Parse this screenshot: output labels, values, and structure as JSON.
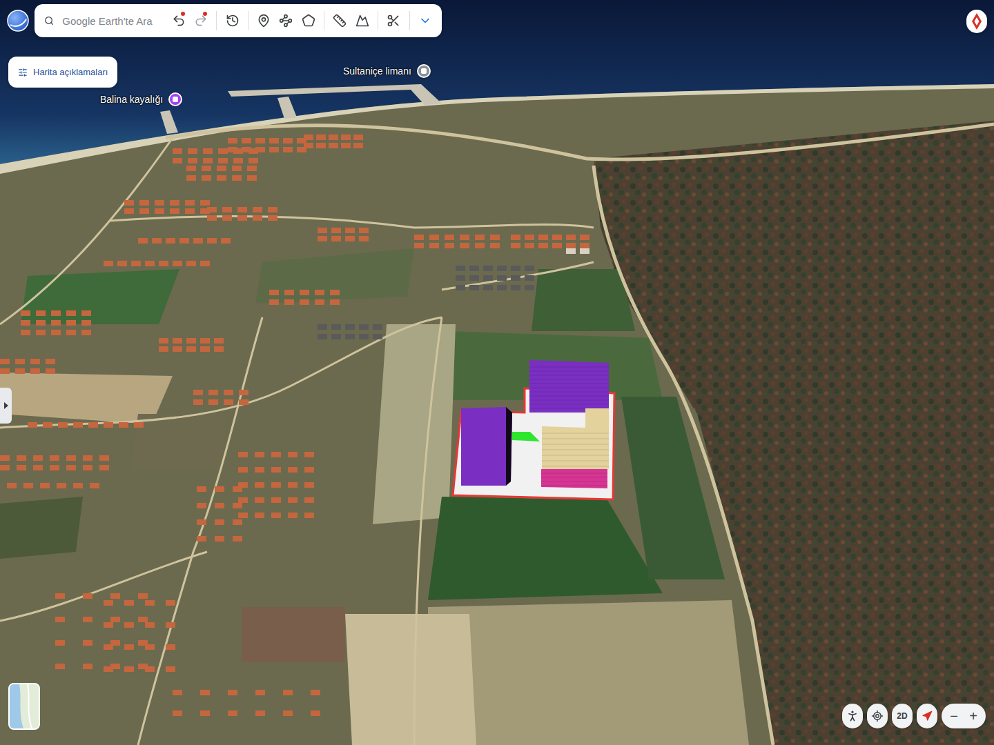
{
  "search": {
    "placeholder": "Google Earth'te Ara"
  },
  "toolbar": {
    "undo_badge": true,
    "redo_badge": true
  },
  "legend_button": {
    "label": "Harita açıklamaları"
  },
  "places": [
    {
      "label": "Sultaniçe limanı",
      "color": "#8a8f98"
    },
    {
      "label": "Balina kayalığı",
      "color": "#a142f4"
    }
  ],
  "site": {
    "boundary_color": "#e53935",
    "ground_color": "#f1f1f1"
  },
  "buildings": [
    {
      "color": "#7a2fc2"
    },
    {
      "color": "#7a2fc2"
    },
    {
      "color": "#e3d29c"
    },
    {
      "color": "#d63593"
    },
    {
      "color": "#2ee62e"
    }
  ],
  "controls": {
    "view_toggle": "2D",
    "zoom_out": "−",
    "zoom_in": "+"
  }
}
